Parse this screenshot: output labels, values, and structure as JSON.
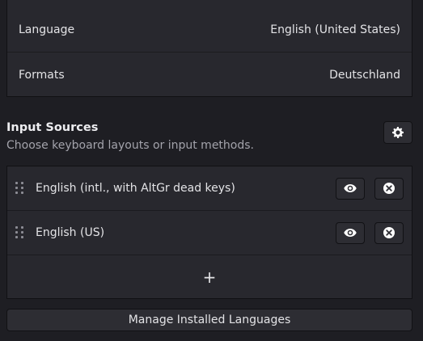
{
  "region": {
    "language_label": "Language",
    "language_value": "English (United States)",
    "formats_label": "Formats",
    "formats_value": "Deutschland"
  },
  "input_sources": {
    "title": "Input Sources",
    "subtitle": "Choose keyboard layouts or input methods.",
    "settings_icon": "gear-icon",
    "items": [
      {
        "label": "English (intl., with AltGr dead keys)",
        "preview_icon": "eye-icon",
        "remove_icon": "close-circle-icon"
      },
      {
        "label": "English (US)",
        "preview_icon": "eye-icon",
        "remove_icon": "close-circle-icon"
      }
    ],
    "add_label": "+"
  },
  "manage_label": "Manage Installed Languages",
  "colors": {
    "background": "#1e1e23",
    "card": "#28282e",
    "button": "#2d2d33",
    "text": "#e3e3e6",
    "muted": "#a3a3ab"
  }
}
